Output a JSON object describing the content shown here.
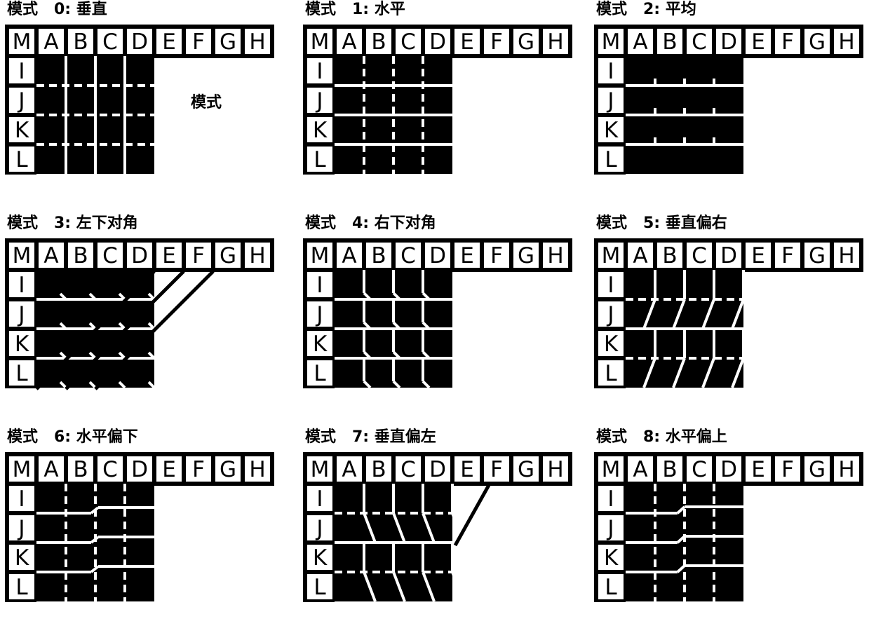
{
  "figure": {
    "panel_count": 9,
    "columns": 3,
    "rows": 3,
    "background_color": "#ffffff",
    "ink_color": "#000000",
    "block_fill_color": "#000000",
    "cell_label_bg": "#ffffff"
  },
  "grid": {
    "column_headers": [
      "M",
      "A",
      "B",
      "C",
      "D",
      "E",
      "F",
      "G",
      "H"
    ],
    "row_headers": [
      "I",
      "J",
      "K",
      "L"
    ],
    "block_columns": [
      "A",
      "B",
      "C",
      "D"
    ],
    "block_rows": [
      "I",
      "J",
      "K",
      "L"
    ]
  },
  "annotation": {
    "label": "模式",
    "panel_index": 0
  },
  "panels": [
    {
      "index": 0,
      "title": "模式   0: 垂直",
      "mode_word": "模式",
      "mode_number": "0",
      "mode_name": "垂直",
      "pattern": "vertical",
      "note": "模式"
    },
    {
      "index": 1,
      "title": "模式   1: 水平",
      "mode_word": "模式",
      "mode_number": "1",
      "mode_name": "水平",
      "pattern": "horizontal",
      "note": ""
    },
    {
      "index": 2,
      "title": "模式   2: 平均",
      "mode_word": "模式",
      "mode_number": "2",
      "mode_name": "平均",
      "pattern": "average",
      "note": ""
    },
    {
      "index": 3,
      "title": "模式   3: 左下对角",
      "mode_word": "模式",
      "mode_number": "3",
      "mode_name": "左下对角",
      "pattern": "diagonal-down-left",
      "note": ""
    },
    {
      "index": 4,
      "title": "模式   4: 右下对角",
      "mode_word": "模式",
      "mode_number": "4",
      "mode_name": "右下对角",
      "pattern": "diagonal-down-right",
      "note": ""
    },
    {
      "index": 5,
      "title": "模式   5: 垂直偏右",
      "mode_word": "模式",
      "mode_number": "5",
      "mode_name": "垂直偏右",
      "pattern": "vertical-right",
      "note": ""
    },
    {
      "index": 6,
      "title": "模式   6: 水平偏下",
      "mode_word": "模式",
      "mode_number": "6",
      "mode_name": "水平偏下",
      "pattern": "horizontal-down",
      "note": ""
    },
    {
      "index": 7,
      "title": "模式   7: 垂直偏左",
      "mode_word": "模式",
      "mode_number": "7",
      "mode_name": "垂直偏左",
      "pattern": "vertical-left",
      "note": ""
    },
    {
      "index": 8,
      "title": "模式   8: 水平偏上",
      "mode_word": "模式",
      "mode_number": "8",
      "mode_name": "水平偏上",
      "pattern": "horizontal-up",
      "note": ""
    }
  ]
}
